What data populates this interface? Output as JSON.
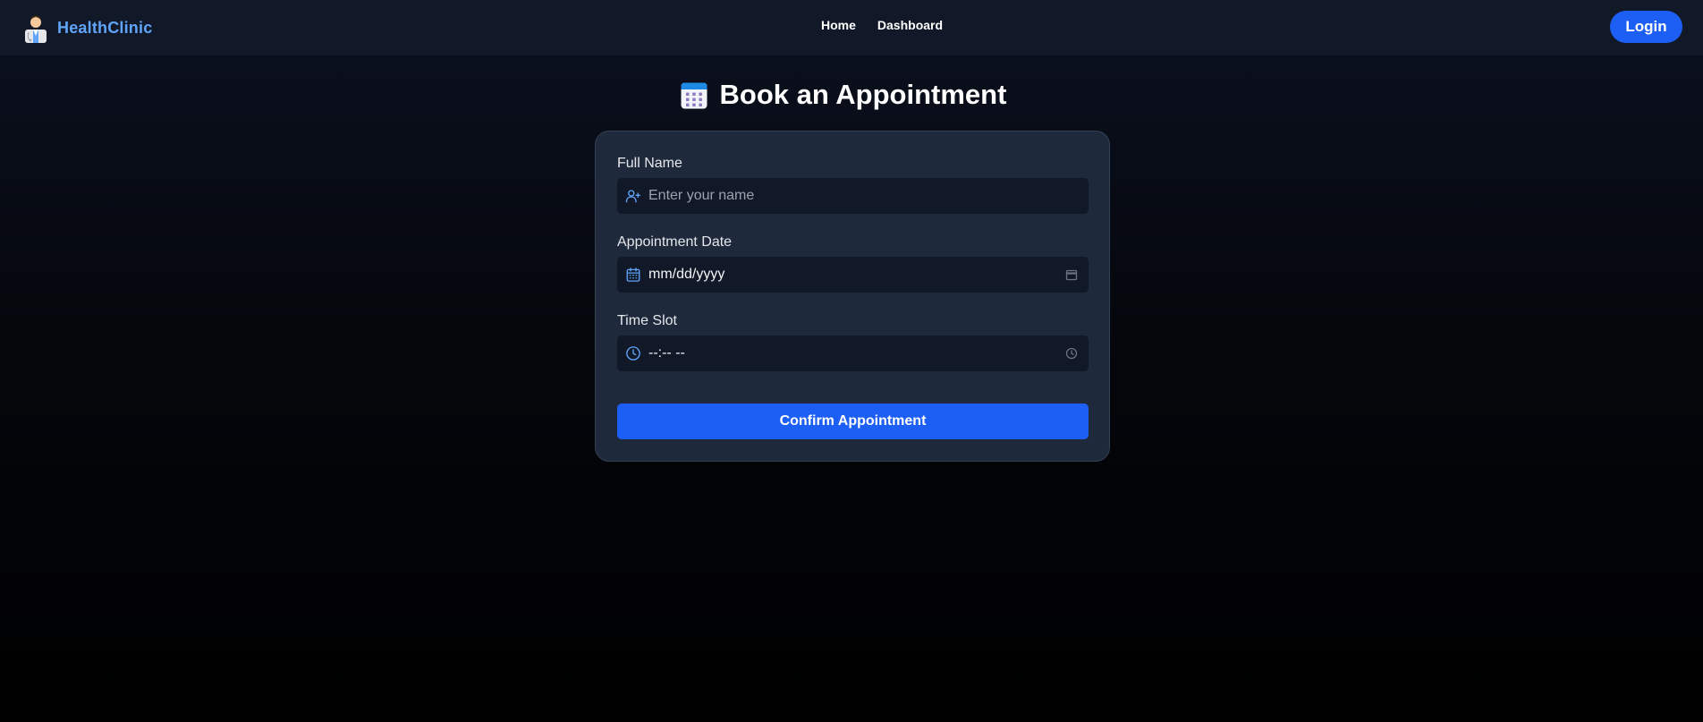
{
  "brand": {
    "name": "HealthClinic",
    "logo_icon": "doctor-icon"
  },
  "nav": {
    "links": [
      "Home",
      "Dashboard"
    ]
  },
  "login_label": "Login",
  "page": {
    "title": "Book an Appointment",
    "title_icon": "calendar-icon"
  },
  "form": {
    "name": {
      "label": "Full Name",
      "placeholder": "Enter your name",
      "icon": "user-plus-icon"
    },
    "date": {
      "label": "Appointment Date",
      "value": "mm/dd/yyyy",
      "icon": "calendar-icon"
    },
    "time": {
      "label": "Time Slot",
      "value": "--:-- --",
      "icon": "clock-icon"
    },
    "submit_label": "Confirm Appointment"
  },
  "colors": {
    "accent": "#1d5ff5",
    "brand": "#60a5fa",
    "card": "#1e293b",
    "input": "#111827",
    "navbar": "#111827"
  }
}
